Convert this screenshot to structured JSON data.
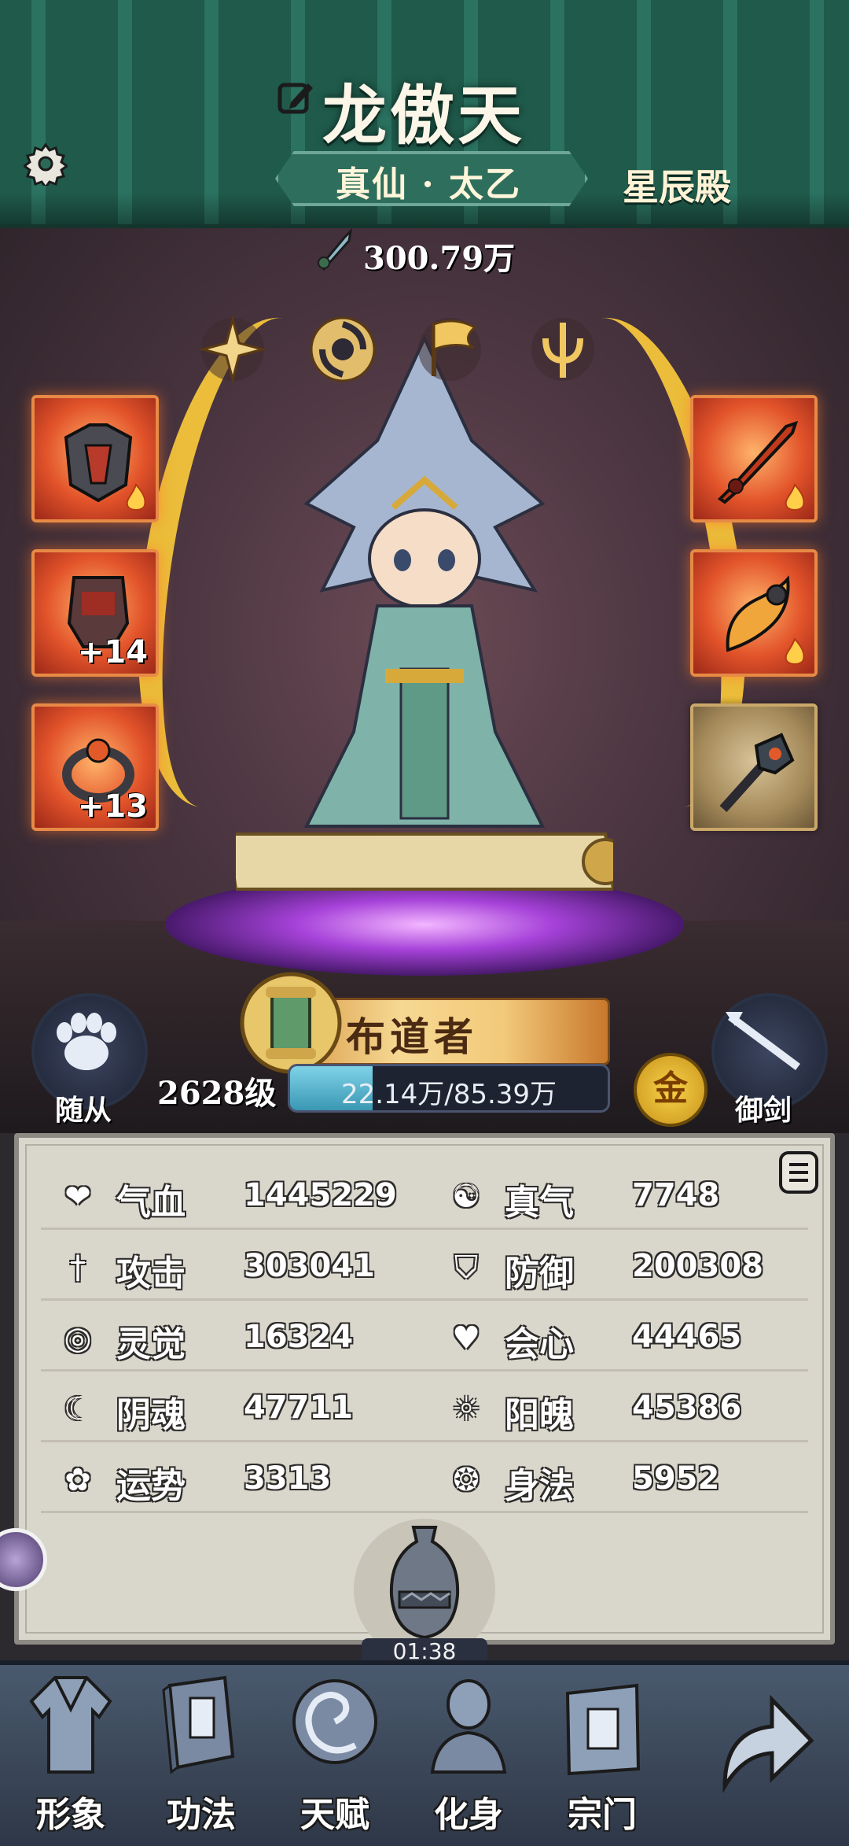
{
  "header": {
    "player_name": "龙傲天",
    "realm": "真仙 · 太乙",
    "sect": "星辰殿"
  },
  "combat": {
    "power": "300.79万"
  },
  "equipment": {
    "left": [
      {
        "name": "armor",
        "enhance": ""
      },
      {
        "name": "gauntlet",
        "enhance": "+14"
      },
      {
        "name": "ring",
        "enhance": "+13"
      }
    ],
    "right": [
      {
        "name": "sword",
        "enhance": ""
      },
      {
        "name": "horn",
        "enhance": ""
      },
      {
        "name": "mace",
        "enhance": ""
      }
    ]
  },
  "title": {
    "text": "布道者"
  },
  "level": {
    "label": "2628级",
    "exp_text": "22.14万/85.39万",
    "exp_fraction": 0.259
  },
  "buttons": {
    "pet_label": "随从",
    "sword_label": "御剑",
    "gold_label": "金"
  },
  "stats": [
    {
      "label": "气血",
      "value": "1445229",
      "icon": "heart-icon"
    },
    {
      "label": "真气",
      "value": "7748",
      "icon": "yinyang-icon"
    },
    {
      "label": "攻击",
      "value": "303041",
      "icon": "sword-icon"
    },
    {
      "label": "防御",
      "value": "200308",
      "icon": "shield-icon"
    },
    {
      "label": "灵觉",
      "value": "16324",
      "icon": "eye-icon"
    },
    {
      "label": "会心",
      "value": "44465",
      "icon": "crit-heart-icon"
    },
    {
      "label": "阴魂",
      "value": "47711",
      "icon": "yin-soul-icon"
    },
    {
      "label": "阳魄",
      "value": "45386",
      "icon": "yang-soul-icon"
    },
    {
      "label": "运势",
      "value": "3313",
      "icon": "luck-icon"
    },
    {
      "label": "身法",
      "value": "5952",
      "icon": "swirl-icon"
    }
  ],
  "timer": "01:38",
  "nav": [
    {
      "label": "形象",
      "icon": "robe-icon"
    },
    {
      "label": "功法",
      "icon": "book-icon"
    },
    {
      "label": "天赋",
      "icon": "spiral-icon"
    },
    {
      "label": "化身",
      "icon": "avatar-icon"
    },
    {
      "label": "宗门",
      "icon": "gate-icon"
    }
  ],
  "colors": {
    "header": "#1f5a4a",
    "slot_fire": "#e2532a",
    "exp_fill": "#3a97b3",
    "panel": "#d9d6cc"
  }
}
